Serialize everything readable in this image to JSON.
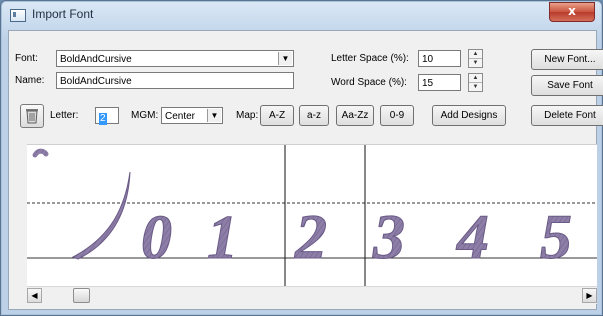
{
  "window": {
    "title": "Import Font",
    "close_glyph": "x"
  },
  "form": {
    "font_label": "Font:",
    "font_value": "BoldAndCursive",
    "name_label": "Name:",
    "name_value": "BoldAndCursive",
    "letter_space_label": "Letter Space (%):",
    "letter_space_value": "10",
    "word_space_label": "Word Space (%):",
    "word_space_value": "15",
    "letter_label": "Letter:",
    "letter_value": "2",
    "mgm_label": "MGM:",
    "mgm_value": "Center",
    "map_label": "Map:"
  },
  "buttons": {
    "new_font": "New Font...",
    "save_font": "Save Font",
    "delete_font": "Delete Font",
    "map_az_upper": "A-Z",
    "map_az_lower": "a-z",
    "map_aazz": "Aa-Zz",
    "map_09": "0-9",
    "add_designs": "Add Designs"
  },
  "canvas": {
    "glyphs": [
      "0",
      "1",
      "2",
      "3",
      "4",
      "5"
    ],
    "glyph_color": "#8a7aa3"
  },
  "icons": {
    "trash": "trash-icon",
    "dropdown": "chevron-down-icon",
    "spin_up": "arrow-up-icon",
    "spin_down": "arrow-down-icon",
    "scroll_left": "arrow-left-icon",
    "scroll_right": "arrow-right-icon"
  }
}
